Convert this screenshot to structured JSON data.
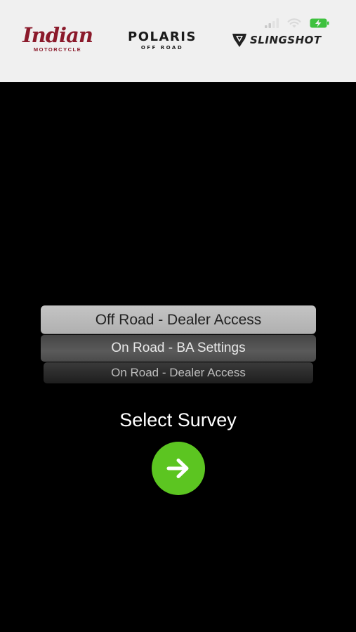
{
  "status_bar": {
    "signal_icon": "cellular-signal-icon",
    "wifi_icon": "wifi-icon",
    "battery_icon": "battery-charging-icon",
    "battery_color": "#3ec13e"
  },
  "header": {
    "logos": {
      "indian": {
        "word": "Indian",
        "sub": "MOTORCYCLE",
        "color": "#8b1a2b"
      },
      "polaris": {
        "word": "POLARIS",
        "sub": "OFF ROAD"
      },
      "slingshot": {
        "word": "SLINGSHOT",
        "icon": "slingshot-shield-icon"
      }
    }
  },
  "picker": {
    "options": [
      {
        "label": "Off Road - Dealer Access",
        "selected": true
      },
      {
        "label": "On Road - BA Settings",
        "selected": false
      },
      {
        "label": "On Road - Dealer Access",
        "selected": false
      }
    ]
  },
  "main": {
    "prompt": "Select Survey",
    "go_button": {
      "icon": "arrow-right-icon",
      "color": "#5cc521"
    }
  }
}
